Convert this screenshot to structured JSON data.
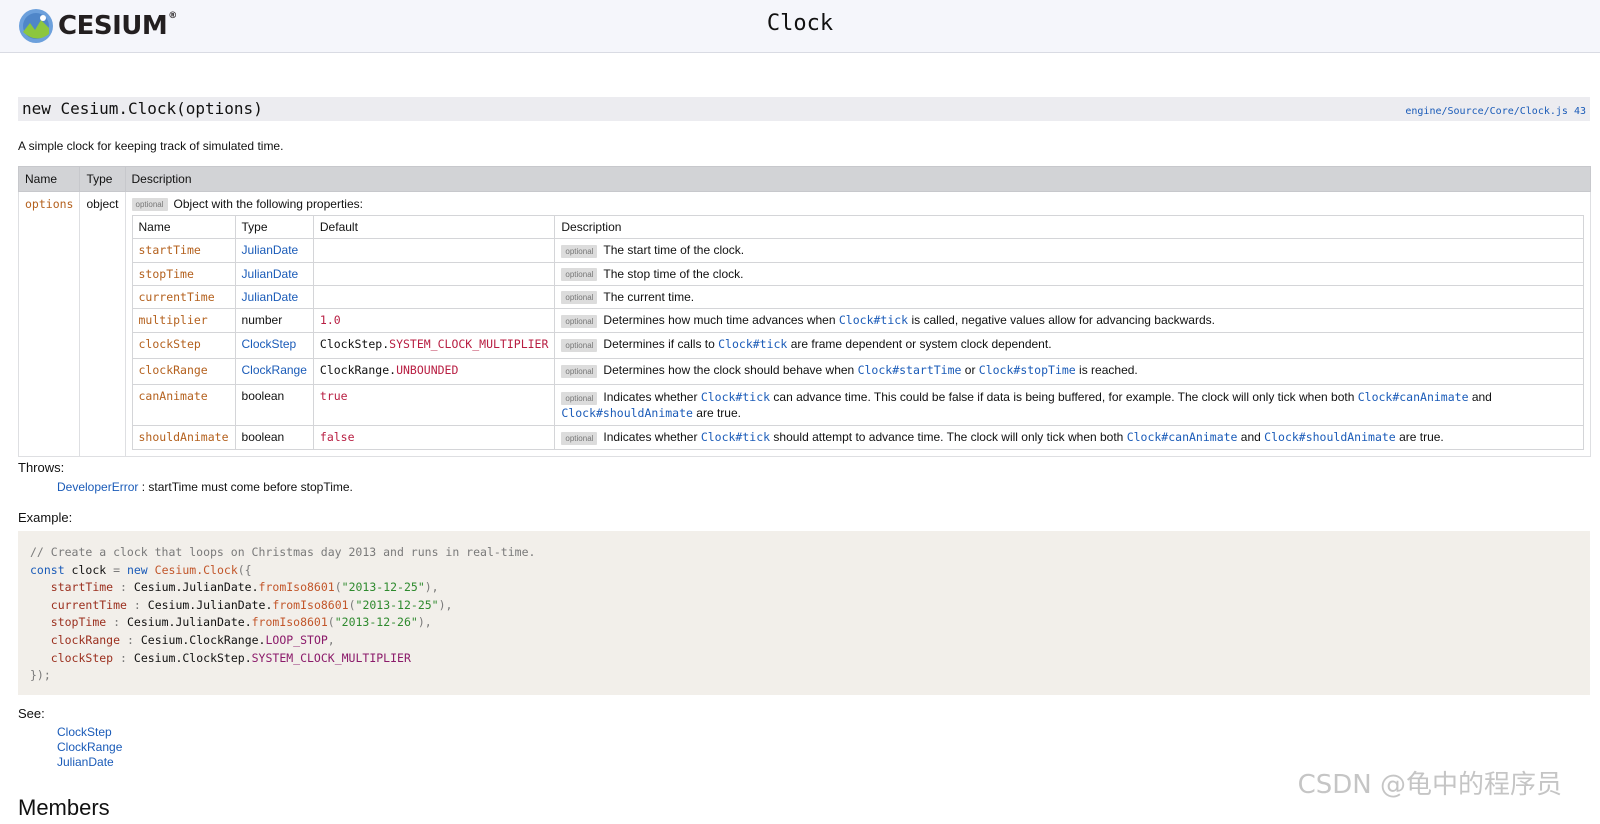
{
  "header": {
    "logo_text": "CESIUM",
    "logo_reg": "®",
    "title": "Clock"
  },
  "constructor": {
    "signature": "new Cesium.Clock(options)",
    "source": "engine/Source/Core/Clock.js 43",
    "description": "A simple clock for keeping track of simulated time."
  },
  "params_table": {
    "headers": [
      "Name",
      "Type",
      "Description"
    ],
    "options_name": "options",
    "options_type": "object",
    "optional_label": "optional",
    "options_desc": "Object with the following properties:",
    "inner_headers": [
      "Name",
      "Type",
      "Default",
      "Description"
    ],
    "rows": [
      {
        "name": "startTime",
        "type": "JulianDate",
        "desc": "The start time of the clock."
      },
      {
        "name": "stopTime",
        "type": "JulianDate",
        "desc": "The stop time of the clock."
      },
      {
        "name": "currentTime",
        "type": "JulianDate",
        "desc": "The current time."
      },
      {
        "name": "multiplier",
        "type": "number",
        "default": "1.0",
        "desc_pre": "Determines how much time advances when ",
        "desc_link": "Clock#tick",
        "desc_post": " is called, negative values allow for advancing backwards."
      },
      {
        "name": "clockStep",
        "type": "ClockStep",
        "default_obj": "ClockStep",
        "default_val": "SYSTEM_CLOCK_MULTIPLIER",
        "desc_pre": "Determines if calls to ",
        "desc_link": "Clock#tick",
        "desc_post": " are frame dependent or system clock dependent."
      },
      {
        "name": "clockRange",
        "type": "ClockRange",
        "default_obj": "ClockRange",
        "default_val": "UNBOUNDED",
        "desc_pre": "Determines how the clock should behave when ",
        "desc_link1": "Clock#startTime",
        "desc_mid": " or ",
        "desc_link2": "Clock#stopTime",
        "desc_post": " is reached."
      },
      {
        "name": "canAnimate",
        "type": "boolean",
        "default": "true",
        "desc_pre": "Indicates whether ",
        "desc_link1": "Clock#tick",
        "desc_mid1": " can advance time. This could be false if data is being buffered, for example. The clock will only tick when both ",
        "desc_link2": "Clock#canAnimate",
        "desc_mid2": " and ",
        "desc_link3": "Clock#shouldAnimate",
        "desc_post": " are true."
      },
      {
        "name": "shouldAnimate",
        "type": "boolean",
        "default": "false",
        "desc_pre": "Indicates whether ",
        "desc_link1": "Clock#tick",
        "desc_mid1": " should attempt to advance time. The clock will only tick when both ",
        "desc_link2": "Clock#canAnimate",
        "desc_mid2": " and ",
        "desc_link3": "Clock#shouldAnimate",
        "desc_post": " are true."
      }
    ]
  },
  "throws": {
    "heading": "Throws:",
    "type": "DeveloperError",
    "text": " : startTime must come before stopTime."
  },
  "example": {
    "heading": "Example:",
    "comment": "// Create a clock that loops on Christmas day 2013 and runs in real-time.",
    "const_kw": "const",
    "var_name": " clock ",
    "eq": "=",
    "new_kw": " new ",
    "ctor": "Cesium.Clock",
    "open": "({",
    "props": [
      {
        "key": "startTime",
        "obj": "Cesium.JulianDate",
        "fn": "fromIso8601",
        "arg": "\"2013-12-25\"",
        "end": "),"
      },
      {
        "key": "currentTime",
        "obj": "Cesium.JulianDate",
        "fn": "fromIso8601",
        "arg": "\"2013-12-25\"",
        "end": "),"
      },
      {
        "key": "stopTime",
        "obj": "Cesium.JulianDate",
        "fn": "fromIso8601",
        "arg": "\"2013-12-26\"",
        "end": "),"
      }
    ],
    "range_key": "clockRange",
    "range_obj": "Cesium.ClockRange",
    "range_val": "LOOP_STOP",
    "step_key": "clockStep",
    "step_obj": "Cesium.ClockStep",
    "step_val": "SYSTEM_CLOCK_MULTIPLIER",
    "close": "});"
  },
  "see": {
    "heading": "See:",
    "links": [
      "ClockStep",
      "ClockRange",
      "JulianDate"
    ]
  },
  "members_heading": "Members",
  "watermark": "CSDN @龟中的程序员"
}
